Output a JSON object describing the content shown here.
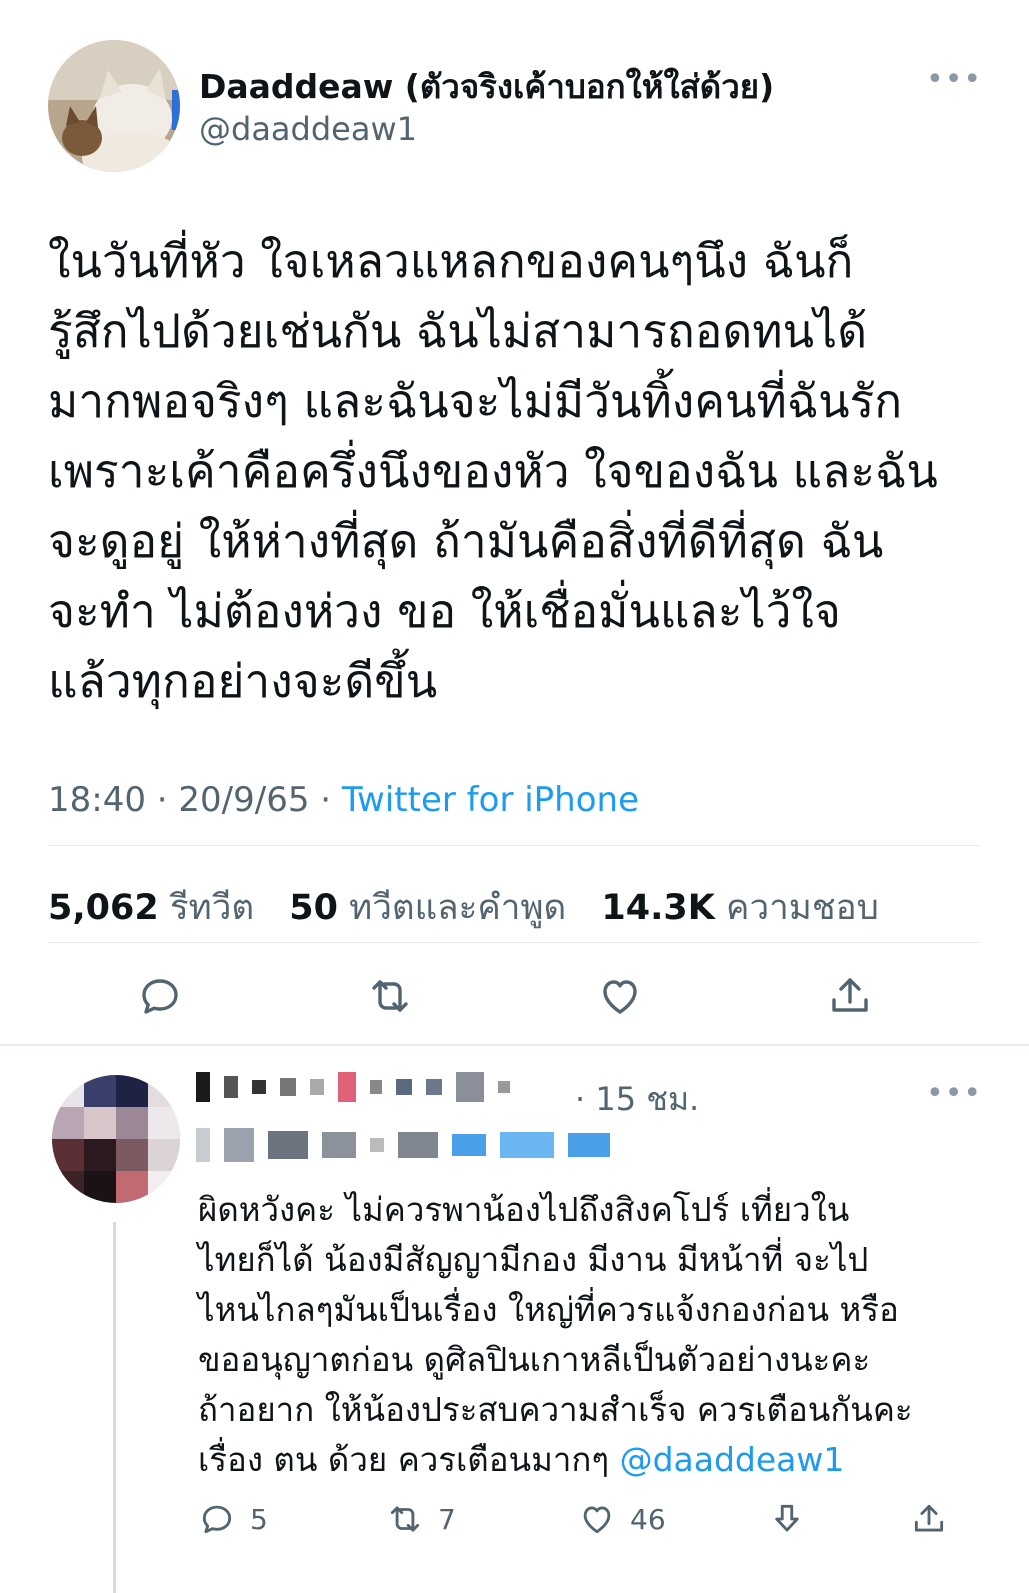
{
  "tweet": {
    "display_name": "Daaddeaw (ตัวจริงเค้าบอกให้ใส่ด้วย)",
    "handle": "@daaddeaw1",
    "more_icon": "more-horizontal-icon",
    "text": "ในวันที่หัว ใจเหลวแหลกของคนๆนึง ฉันก็\nรู้สึกไปด้วยเช่นกัน ฉันไม่สามารถอดทนได้\nมากพอจริงๆ และฉันจะไม่มีวันทิ้งคนที่ฉันรัก\nเพราะเค้าคือครึ่งนึงของหัว ใจของฉัน และฉัน\nจะดูอยู่ ให้ห่างที่สุด ถ้ามันคือสิ่งที่ดีที่สุด ฉัน\nจะทำ ไม่ต้องห่วง ขอ ให้เชื่อมั่นและไว้ใจ\nแล้วทุกอย่างจะดีขึ้น",
    "time": "18:40 · 20/9/65 ·",
    "source": "Twitter for iPhone",
    "stats": {
      "retweets_count": "5,062",
      "retweets_label": "รีทวีต",
      "quotes_count": "50",
      "quotes_label": "ทวีตและคำพูด",
      "likes_count": "14.3K",
      "likes_label": "ความชอบ"
    },
    "actions": [
      "reply-icon",
      "retweet-icon",
      "like-icon",
      "share-icon"
    ]
  },
  "reply": {
    "time": "· 15 ชม.",
    "text": "ผิดหวังคะ ไม่ควรพาน้องไปถึงสิงคโปร์ เที่ยวใน\nไทยก็ได้ น้องมีสัญญามีกอง มีงาน มีหน้าที่ จะไป\nไหนไกลๆมันเป็นเรื่อง ใหญ่ที่ควรแจ้งกองก่อน หรือ\nขออนุญาตก่อน ดูศิลปินเกาหลีเป็นตัวอย่างนะคะ\nถ้าอยาก ให้น้องประสบความสำเร็จ ควรเตือนกันคะ\nเรื่อง ตน ด้วย ควรเตือนมากๆ ",
    "mention": "@daaddeaw1",
    "reply_count": "5",
    "retweet_count": "7",
    "like_count": "46"
  },
  "colors": {
    "accent": "#1d9bf0",
    "muted": "#536471",
    "text": "#0f1419",
    "divider": "#e6ecf0"
  }
}
